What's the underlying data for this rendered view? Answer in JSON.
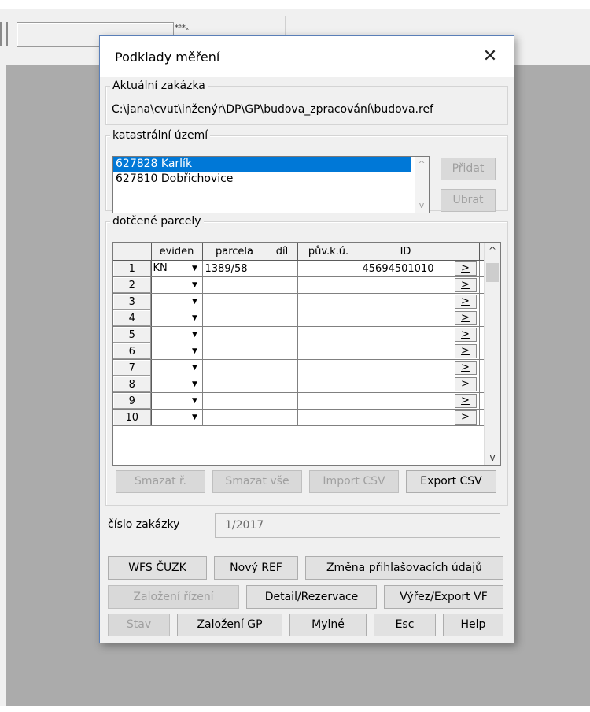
{
  "background_app": {
    "toolbar_glyph": "*ᵃ*ₓ"
  },
  "dialog": {
    "title": "Podklady měření",
    "close_label": "✕",
    "current_job": {
      "legend": "Aktuální zakázka",
      "path": "C:\\jana\\cvut\\inženýr\\DP\\GP\\budova_zpracování\\budova.ref"
    },
    "cadastral": {
      "legend": "katastrální území",
      "items": [
        {
          "label": "627828 Karlík",
          "selected": true
        },
        {
          "label": "627810 Dobřichovice",
          "selected": false
        }
      ],
      "add_label": "Přidat",
      "remove_label": "Ubrat",
      "scroll_up": "^",
      "scroll_down": "v"
    },
    "parcels": {
      "legend": "dotčené parcely",
      "columns": [
        "eviden",
        "parcela",
        "díl",
        "pův.k.ú.",
        "ID"
      ],
      "rows": [
        {
          "num": "1",
          "eviden": "KN",
          "parcela": "1389/58",
          "dil": "",
          "puv": "",
          "id": "45694501010"
        },
        {
          "num": "2",
          "eviden": "",
          "parcela": "",
          "dil": "",
          "puv": "",
          "id": ""
        },
        {
          "num": "3",
          "eviden": "",
          "parcela": "",
          "dil": "",
          "puv": "",
          "id": ""
        },
        {
          "num": "4",
          "eviden": "",
          "parcela": "",
          "dil": "",
          "puv": "",
          "id": ""
        },
        {
          "num": "5",
          "eviden": "",
          "parcela": "",
          "dil": "",
          "puv": "",
          "id": ""
        },
        {
          "num": "6",
          "eviden": "",
          "parcela": "",
          "dil": "",
          "puv": "",
          "id": ""
        },
        {
          "num": "7",
          "eviden": "",
          "parcela": "",
          "dil": "",
          "puv": "",
          "id": ""
        },
        {
          "num": "8",
          "eviden": "",
          "parcela": "",
          "dil": "",
          "puv": "",
          "id": ""
        },
        {
          "num": "9",
          "eviden": "",
          "parcela": "",
          "dil": "",
          "puv": "",
          "id": ""
        },
        {
          "num": "10",
          "eviden": "",
          "parcela": "",
          "dil": "",
          "puv": "",
          "id": ""
        }
      ],
      "go_label": ">",
      "dropdown_glyph": "▼",
      "buttons": {
        "delete_row": "Smazat ř.",
        "delete_all": "Smazat vše",
        "import_csv": "Import CSV",
        "export_csv": "Export CSV"
      },
      "scroll_up": "^",
      "scroll_down": "v"
    },
    "job_number": {
      "label": "číslo zakázky",
      "value": "1/2017"
    },
    "actions": {
      "wfs": "WFS ČUZK",
      "new_ref": "Nový REF",
      "change_login": "Změna přihlašovacích údajů",
      "create_proceeding": "Založení řízení",
      "detail_reservation": "Detail/Rezervace",
      "cutout_export": "Výřez/Export VF",
      "status": "Stav",
      "create_gp": "Založení GP",
      "wrong": "Mylné",
      "esc": "Esc",
      "help": "Help"
    }
  }
}
